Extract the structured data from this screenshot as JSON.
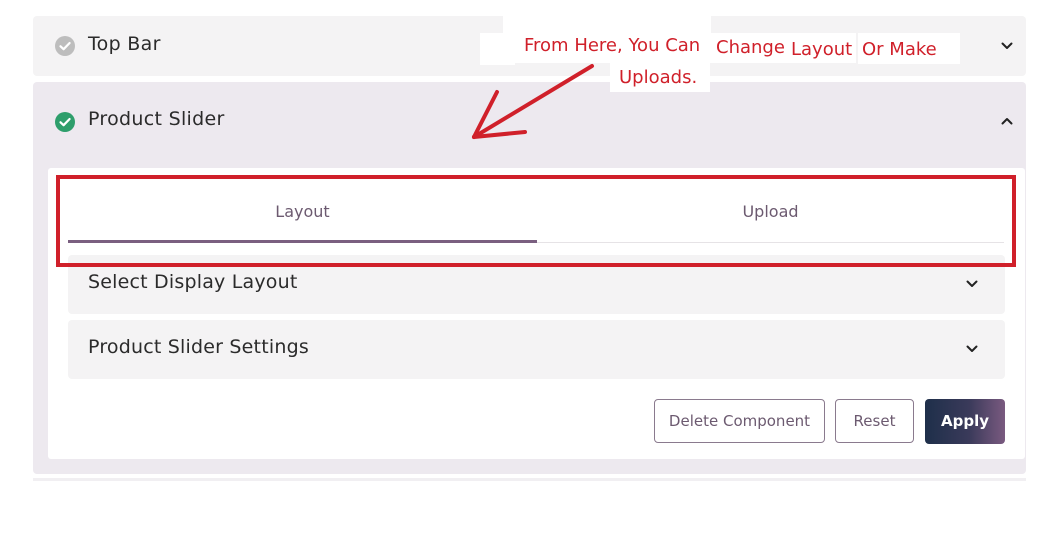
{
  "accordions": {
    "top_bar": {
      "title": "Top Bar",
      "status": "complete-gray",
      "icon": "chevron-down-icon"
    },
    "product_slider": {
      "title": "Product Slider",
      "status": "complete-green",
      "icon": "chevron-up-icon"
    }
  },
  "tabs": [
    {
      "label": "Layout",
      "active": true
    },
    {
      "label": "Upload",
      "active": false
    }
  ],
  "sub_sections": [
    {
      "label": "Select Display Layout",
      "icon": "chevron-down-icon"
    },
    {
      "label": "Product Slider Settings",
      "icon": "chevron-down-icon"
    }
  ],
  "actions": {
    "delete_label": "Delete Component",
    "reset_label": "Reset",
    "apply_label": "Apply"
  },
  "annotation": {
    "line1_a": "From Here, You Can",
    "line1_b": "Change",
    "line1_c": "Layout",
    "line1_d": "Or Make",
    "line2": "Uploads."
  },
  "colors": {
    "annotation_red": "#d0202a",
    "check_green": "#2e9e6b",
    "check_gray": "#bdbdbd",
    "tab_active_accent": "#7a5f80",
    "apply_gradient_start": "#1e2f4a",
    "apply_gradient_end": "#7a5a80"
  }
}
